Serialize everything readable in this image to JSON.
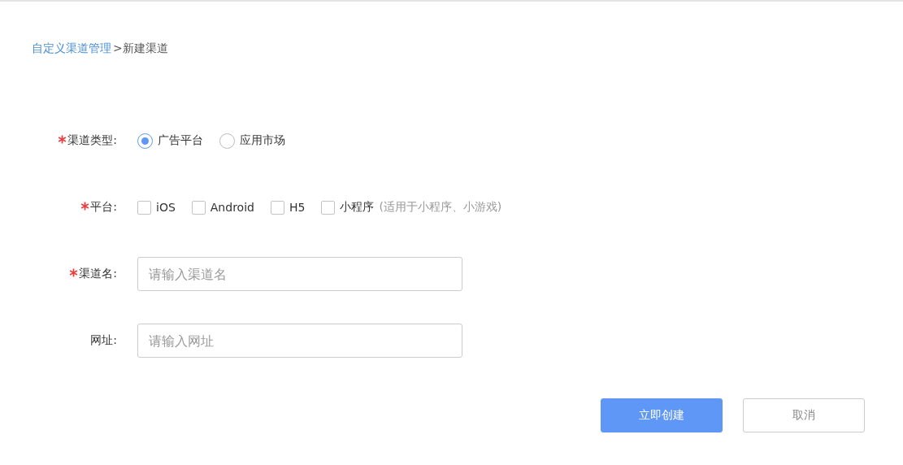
{
  "breadcrumb": {
    "parent": "自定义渠道管理",
    "current": ">新建渠道"
  },
  "form": [
    {
      "kind": "radio",
      "label": "渠道类型:",
      "required": true,
      "options": [
        {
          "label": "广告平台",
          "selected": true
        },
        {
          "label": "应用市场",
          "selected": false
        }
      ]
    },
    {
      "kind": "checkbox",
      "label": "平台:",
      "required": true,
      "options": [
        {
          "label": "iOS",
          "checked": false
        },
        {
          "label": "Android",
          "checked": false
        },
        {
          "label": "H5",
          "checked": false
        },
        {
          "label": "小程序",
          "checked": false,
          "note": "(适用于小程序、小游戏)"
        }
      ]
    },
    {
      "kind": "input",
      "label": "渠道名:",
      "required": true,
      "placeholder": "请输入渠道名"
    },
    {
      "kind": "input",
      "label": "网址:",
      "required": false,
      "placeholder": "请输入网址"
    }
  ],
  "buttons": [
    {
      "label": "立即创建",
      "kind": "primary"
    },
    {
      "label": "取消",
      "kind": "secondary"
    }
  ]
}
